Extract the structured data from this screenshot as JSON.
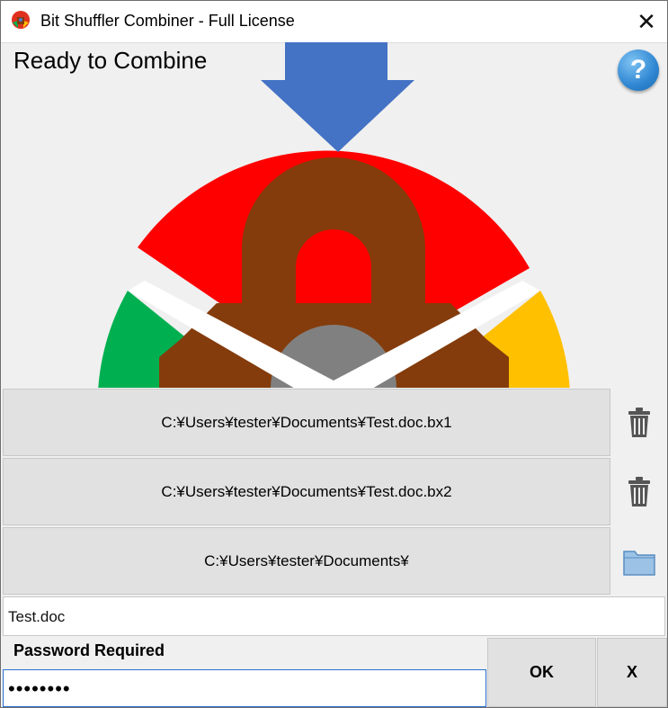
{
  "window": {
    "title": "Bit Shuffler Combiner - Full License",
    "close_label": "✕"
  },
  "status": "Ready to Combine",
  "help_label": "?",
  "files": [
    {
      "path": "C:¥Users¥tester¥Documents¥Test.doc.bx1",
      "icon": "trash-icon"
    },
    {
      "path": "C:¥Users¥tester¥Documents¥Test.doc.bx2",
      "icon": "trash-icon"
    },
    {
      "path": "C:¥Users¥tester¥Documents¥",
      "icon": "folder-icon"
    }
  ],
  "output_filename": "Test.doc",
  "password": {
    "label": "Password Required",
    "value": "••••••••"
  },
  "buttons": {
    "ok": "OK",
    "cancel": "X"
  },
  "colors": {
    "arrow": "#4472c4",
    "red": "#ff0000",
    "green": "#00b050",
    "yellow": "#ffc000",
    "lock": "#843c0c",
    "gray": "#808080"
  }
}
